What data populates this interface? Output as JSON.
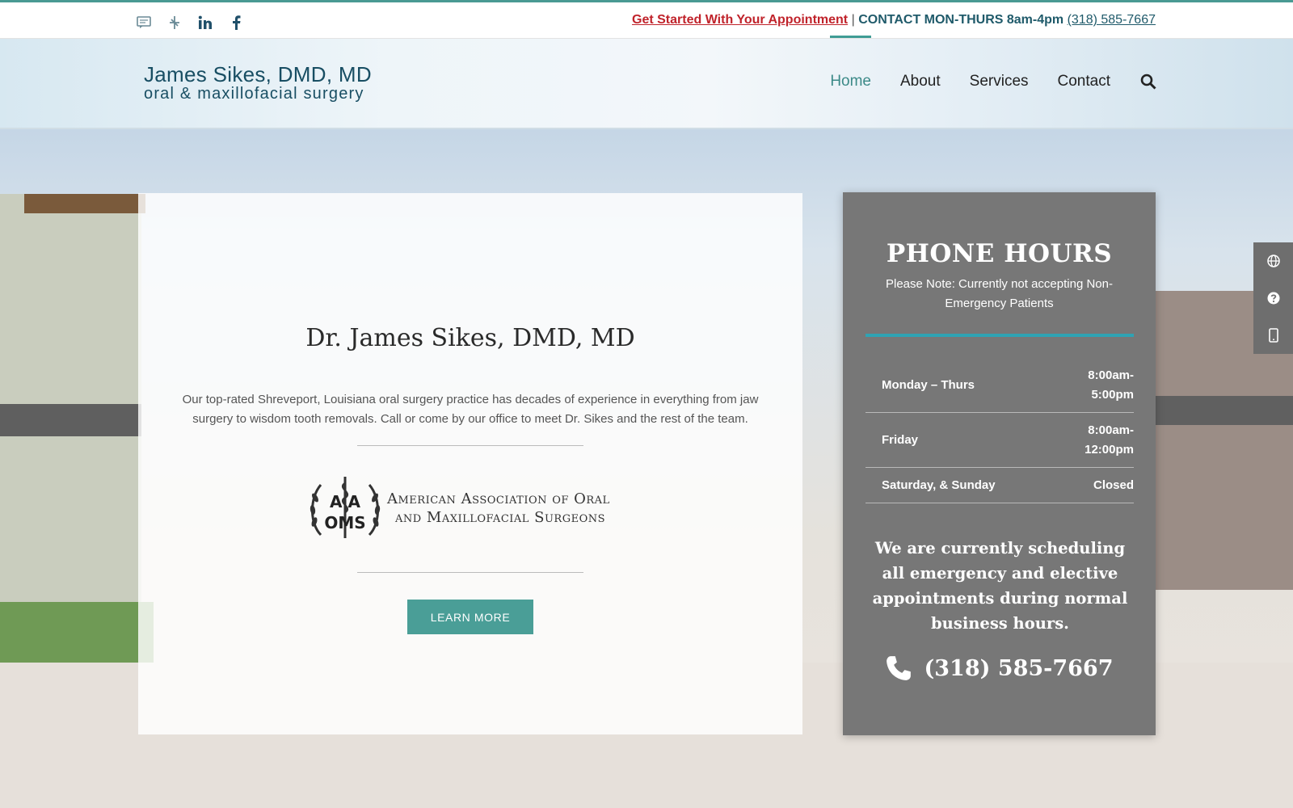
{
  "topbar": {
    "appointment_link": "Get Started With Your Appointment",
    "separator": "|",
    "contact_label": "CONTACT MON-THURS 8am-4pm",
    "phone": "(318) 585-7667",
    "social_icons": [
      "chat-icon",
      "yelp-icon",
      "linkedin-icon",
      "facebook-icon"
    ]
  },
  "header": {
    "logo_line1": "James Sikes, DMD, MD",
    "logo_line2": "oral & maxillofacial surgery",
    "nav": [
      "Home",
      "About",
      "Services",
      "Contact"
    ],
    "active_nav": "Home"
  },
  "card": {
    "title": "Dr. James Sikes, DMD, MD",
    "description": "Our top-rated Shreveport, Louisiana oral surgery practice has decades of experience in everything from jaw surgery to wisdom tooth removals. Call or come by our office to meet Dr. Sikes and the rest of the team.",
    "aaoms_line1": "American Association of Oral",
    "aaoms_line2": "and Maxillofacial Surgeons",
    "emblem_text_top": "A A",
    "emblem_text_bottom": "OMS",
    "learn_more": "LEARN MORE"
  },
  "panel": {
    "title": "PHONE HOURS",
    "note": "Please Note: Currently not accepting Non-Emergency Patients",
    "hours": [
      {
        "day": "Monday – Thurs",
        "time_line1": "8:00am-",
        "time_line2": "5:00pm"
      },
      {
        "day": "Friday",
        "time_line1": "8:00am-",
        "time_line2": "12:00pm"
      },
      {
        "day": "Saturday, & Sunday",
        "time_line1": "Closed",
        "time_line2": ""
      }
    ],
    "schedule_text": "We are currently scheduling all emergency and elective appointments during normal business hours.",
    "phone": "(318) 585-7667"
  },
  "side_widget": [
    "globe-icon",
    "question-icon",
    "mobile-icon"
  ],
  "colors": {
    "accent_teal": "#4a9e97",
    "appointment_red": "#c0232b",
    "panel_gray": "#777777",
    "bar_blue": "#2fa3b3",
    "navy": "#184e63"
  }
}
